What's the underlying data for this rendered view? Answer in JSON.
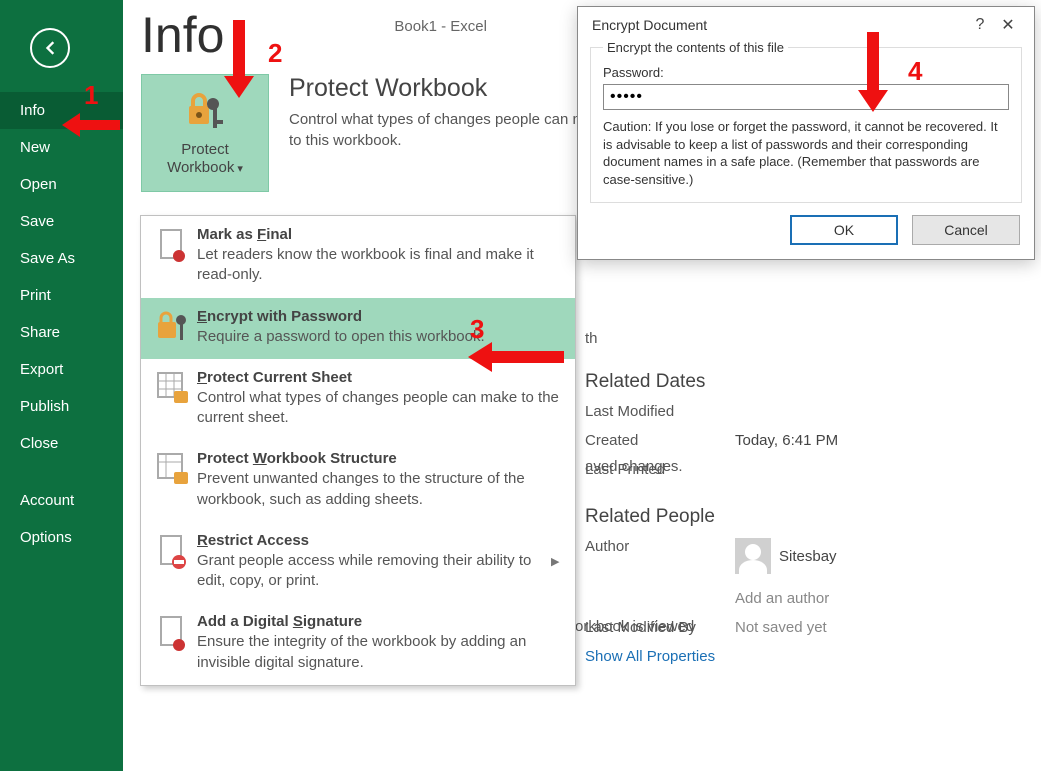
{
  "window": {
    "title": "Book1 - Excel"
  },
  "page_title": "Info",
  "sidebar": {
    "items": [
      {
        "label": "Info",
        "active": true
      },
      {
        "label": "New"
      },
      {
        "label": "Open"
      },
      {
        "label": "Save"
      },
      {
        "label": "Save As"
      },
      {
        "label": "Print"
      },
      {
        "label": "Share"
      },
      {
        "label": "Export"
      },
      {
        "label": "Publish"
      },
      {
        "label": "Close"
      }
    ],
    "footer": [
      {
        "label": "Account"
      },
      {
        "label": "Options"
      }
    ]
  },
  "protect": {
    "button_line1": "Protect",
    "button_line2": "Workbook",
    "heading": "Protect Workbook",
    "desc": "Control what types of changes people can make to this workbook."
  },
  "menu": {
    "items": [
      {
        "title": "Mark as Final",
        "u": "F",
        "desc": "Let readers know the workbook is final and make it read-only."
      },
      {
        "title": "Encrypt with Password",
        "u": "E",
        "desc": "Require a password to open this workbook."
      },
      {
        "title": "Protect Current Sheet",
        "u": "P",
        "desc": "Control what types of changes people can make to the current sheet."
      },
      {
        "title": "Protect Workbook Structure",
        "u": "W",
        "desc": "Prevent unwanted changes to the structure of the workbook, such as adding sheets."
      },
      {
        "title": "Restrict Access",
        "u": "R",
        "desc": "Grant people access while removing their ability to edit, copy, or print.",
        "submenu": true
      },
      {
        "title": "Add a Digital Signature",
        "u": "S",
        "desc": "Ensure the integrity of the workbook by adding an invisible digital signature."
      }
    ]
  },
  "fragments": {
    "th": "th",
    "saved": "aved changes.",
    "viewed": "orkbook is viewed"
  },
  "related_dates": {
    "heading": "Related Dates",
    "last_modified_label": "Last Modified",
    "last_modified_value": "",
    "created_label": "Created",
    "created_value": "Today, 6:41 PM",
    "last_printed_label": "Last Printed",
    "last_printed_value": ""
  },
  "related_people": {
    "heading": "Related People",
    "author_label": "Author",
    "author_name": "Sitesbay",
    "add_author": "Add an author",
    "lmb_label": "Last Modified By",
    "lmb_value": "Not saved yet"
  },
  "show_all": "Show All Properties",
  "dialog": {
    "title": "Encrypt Document",
    "legend": "Encrypt the contents of this file",
    "password_label": "Password:",
    "password_value": "•••••",
    "caution": "Caution: If you lose or forget the password, it cannot be recovered. It is advisable to keep a list of passwords and their corresponding document names in a safe place. (Remember that passwords are case-sensitive.)",
    "ok": "OK",
    "cancel": "Cancel"
  },
  "annotations": {
    "n1": "1",
    "n2": "2",
    "n3": "3",
    "n4": "4"
  }
}
